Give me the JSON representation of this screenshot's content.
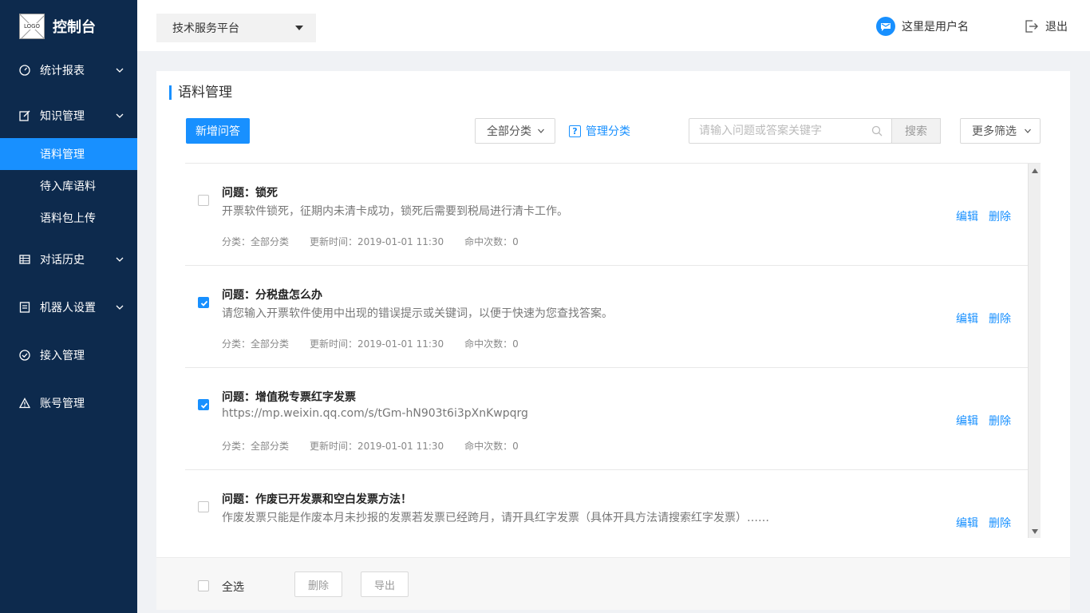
{
  "sidebar": {
    "logo_text": "LOGO",
    "app_title": "控制台",
    "items": [
      {
        "label": "统计报表"
      },
      {
        "label": "知识管理"
      },
      {
        "label": "语料管理"
      },
      {
        "label": "待入库语料"
      },
      {
        "label": "语料包上传"
      },
      {
        "label": "对话历史"
      },
      {
        "label": "机器人设置"
      },
      {
        "label": "接入管理"
      },
      {
        "label": "账号管理"
      }
    ]
  },
  "header": {
    "platform": "技术服务平台",
    "username": "这里是用户名",
    "logout": "退出"
  },
  "main": {
    "title": "语料管理",
    "add_button": "新增问答",
    "category_select": "全部分类",
    "manage_category": "管理分类",
    "search_placeholder": "请输入问题或答案关键字",
    "search_button": "搜索",
    "more_filter": "更多筛选",
    "items": [
      {
        "title": "问题：锁死",
        "answer": "开票软件锁死，征期内未清卡成功，锁死后需要到税局进行清卡工作。",
        "category": "分类：全部分类",
        "updated": "更新时间：2019-01-01 11:30",
        "hits": "命中次数：0",
        "checked": false
      },
      {
        "title": "问题：分税盘怎么办",
        "answer": "请您输入开票软件使用中出现的错误提示或关键词，以便于快速为您查找答案。",
        "category": "分类：全部分类",
        "updated": "更新时间：2019-01-01 11:30",
        "hits": "命中次数：0",
        "checked": true
      },
      {
        "title": "问题：增值税专票红字发票",
        "answer": "https://mp.weixin.qq.com/s/tGm-hN903t6i3pXnKwpqrg",
        "category": "分类：全部分类",
        "updated": "更新时间：2019-01-01 11:30",
        "hits": "命中次数：0",
        "checked": true
      },
      {
        "title": "问题：作废已开发票和空白发票方法！",
        "answer": "作废发票只能是作废本月未抄报的发票若发票已经跨月，请开具红字发票（具体开具方法请搜索红字发票）……",
        "category": "",
        "updated": "",
        "hits": "",
        "checked": false
      }
    ],
    "edit_label": "编辑",
    "delete_label": "删除"
  },
  "footer": {
    "select_all": "全选",
    "delete": "删除",
    "export": "导出"
  },
  "colors": {
    "sidebar_bg": "#0d2a4d",
    "accent": "#1890ff"
  }
}
